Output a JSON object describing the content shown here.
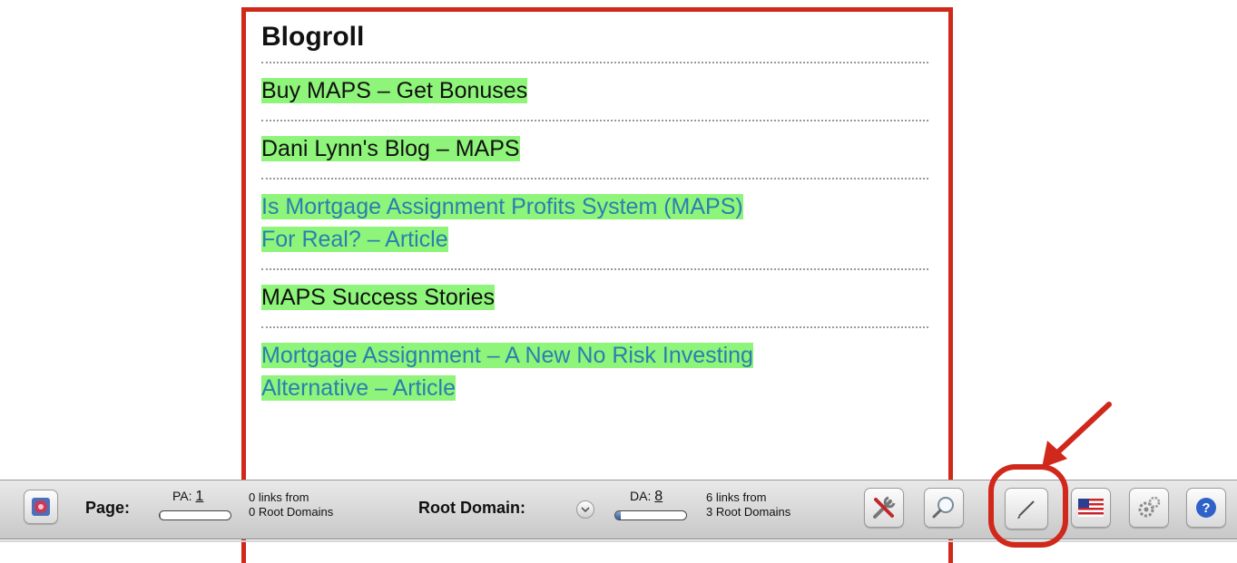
{
  "blogroll": {
    "title": "Blogroll",
    "items": [
      {
        "line1": "Buy MAPS – Get Bonuses",
        "line2": "",
        "color": "black"
      },
      {
        "line1": "Dani Lynn's Blog – MAPS",
        "line2": "",
        "color": "black"
      },
      {
        "line1": "Is Mortgage Assignment Profits System (MAPS)",
        "line2": "For Real? – Article",
        "color": "blue"
      },
      {
        "line1": "MAPS Success Stories",
        "line2": "",
        "color": "black"
      },
      {
        "line1": "Mortgage Assignment – A New No Risk Investing",
        "line2": "Alternative – Article",
        "color": "blue"
      }
    ],
    "highlight_color": "#8ef57a",
    "link_blue": "#2a7fb0"
  },
  "toolbar": {
    "page_label": "Page:",
    "pa_label": "PA:",
    "pa_value": "1",
    "page_links_line1": "0 links from",
    "page_links_line2": "0 Root Domains",
    "root_domain_label": "Root Domain:",
    "da_label": "DA:",
    "da_value": "8",
    "da_fill_fraction": 0.08,
    "pa_fill_fraction": 0.01,
    "domain_links_line1": "6 links from",
    "domain_links_line2": "3 Root Domains",
    "icons": [
      "mozbar-logo-icon",
      "wrench-screwdriver-icon",
      "magnifier-icon",
      "pencil-highlight-icon",
      "us-flag-icon",
      "gears-icon",
      "help-icon"
    ]
  },
  "annotation_color": "#d0281b"
}
